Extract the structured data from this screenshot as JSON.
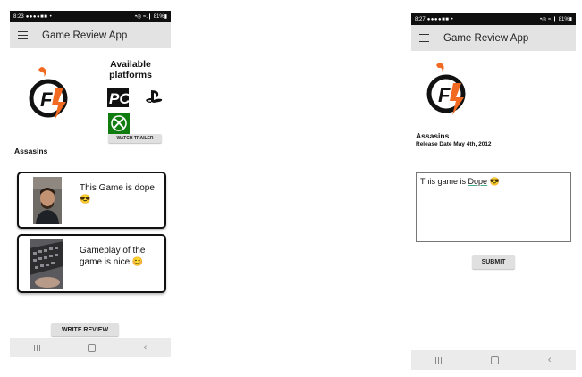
{
  "left_screen": {
    "status": {
      "time": "8:23",
      "icons": "●●●●■■ •",
      "right": "•◎ ≈.❙ 81%▮"
    },
    "app_title": "Game Review App",
    "platforms_heading": "Available platforms",
    "platform_icons": [
      "pc-icon",
      "playstation-icon",
      "xbox-icon"
    ],
    "watch_trailer_label": "WATCH TRAILER",
    "game_title": "Assasins",
    "reviews": [
      {
        "text": "This Game is dope 😎"
      },
      {
        "text": "Gameplay of the game is nice 😊"
      }
    ],
    "write_review_label": "WRITE REVIEW"
  },
  "right_screen": {
    "status": {
      "time": "8:27",
      "icons": "●●●●■■ •",
      "right": "•◎ ≈.❙ 81%▮"
    },
    "app_title": "Game Review App",
    "game_title": "Assasins",
    "release_date": "Release Date May 4th, 2012",
    "review_prefix": "This game is ",
    "review_typed": "Dope",
    "review_suffix": " 😎",
    "submit_label": "SUBMIT"
  },
  "colors": {
    "appbar": "#e3e3e3",
    "statusbar": "#0f0f0f",
    "logo_orange": "#f26a21",
    "xbox_green": "#107c10"
  }
}
